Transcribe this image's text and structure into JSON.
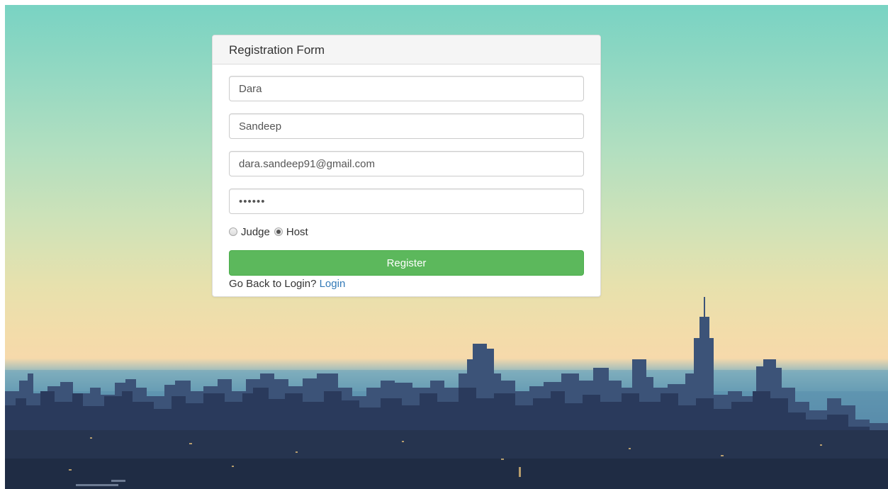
{
  "form": {
    "title": "Registration Form",
    "first_name": "Dara",
    "last_name": "Sandeep",
    "email": "dara.sandeep91@gmail.com",
    "password": "••••••",
    "roles": [
      {
        "label": "Judge",
        "checked": false
      },
      {
        "label": "Host",
        "checked": true
      }
    ],
    "register_label": "Register",
    "back_prompt": "Go Back to Login?",
    "login_link": "Login"
  },
  "colors": {
    "primary_button": "#5cb85c",
    "link": "#337ab7",
    "sky_top": "#79d3c3",
    "sky_horizon": "#f6d9ab",
    "city": "#2c3d5e"
  }
}
